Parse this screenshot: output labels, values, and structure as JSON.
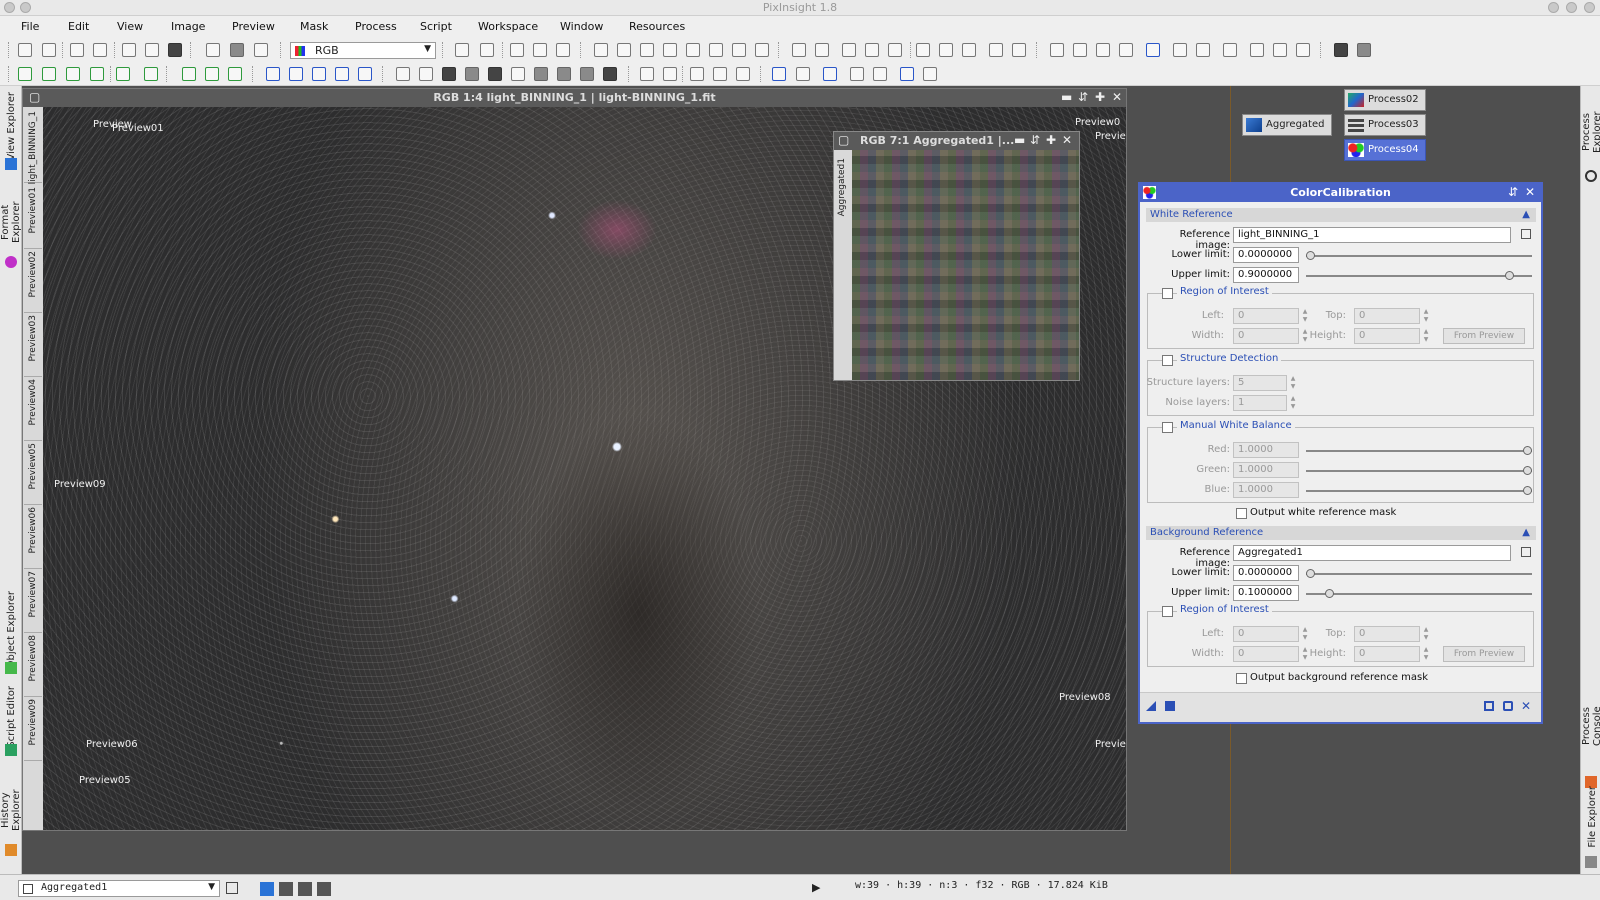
{
  "app": {
    "title": "PixInsight 1.8"
  },
  "menu": [
    "File",
    "Edit",
    "View",
    "Image",
    "Preview",
    "Mask",
    "Process",
    "Script",
    "Workspace",
    "Window",
    "Resources"
  ],
  "toolbar": {
    "channel_select": "RGB"
  },
  "left_dock": [
    "View Explorer",
    "Format Explorer",
    "Object Explorer",
    "Script Editor",
    "History Explorer"
  ],
  "right_dock": [
    "Process Explorer",
    "Process Console",
    "File Explorer"
  ],
  "main_window": {
    "title": "RGB 1:4 light_BINNING_1 | light-BINNING_1.fit",
    "tabs": [
      "light_BINNING_1",
      "Preview01",
      "Preview02",
      "Preview03",
      "Preview04",
      "Preview05",
      "Preview06",
      "Preview07",
      "Preview08",
      "Preview09"
    ],
    "labels": [
      "Preview01",
      "Preview09",
      "Preview06",
      "Preview05",
      "Preview0",
      "Preview08",
      "Previe",
      "Previe"
    ]
  },
  "agg_window": {
    "title": "RGB 7:1 Aggregated1 |...",
    "tab": "Aggregated1"
  },
  "process_icons": [
    {
      "label": "Aggregated"
    },
    {
      "label": "Process02"
    },
    {
      "label": "Process03"
    },
    {
      "label": "Process04"
    }
  ],
  "dialog": {
    "title": "ColorCalibration",
    "white_ref": {
      "header": "White Reference",
      "ref_image_label": "Reference image:",
      "ref_image": "light_BINNING_1",
      "lower_label": "Lower limit:",
      "lower": "0.0000000",
      "upper_label": "Upper limit:",
      "upper": "0.9000000",
      "lower_fraction": 0.0,
      "upper_fraction": 0.9
    },
    "roi1": {
      "label": "Region of Interest",
      "left_label": "Left:",
      "left": "0",
      "top_label": "Top:",
      "top": "0",
      "width_label": "Width:",
      "width": "0",
      "height_label": "Height:",
      "height": "0",
      "from_preview": "From Preview"
    },
    "structure": {
      "label": "Structure Detection",
      "layers_label": "Structure layers:",
      "layers": "5",
      "noise_label": "Noise layers:",
      "noise": "1"
    },
    "mwb": {
      "label": "Manual White Balance",
      "red_label": "Red:",
      "red": "1.0000",
      "green_label": "Green:",
      "green": "1.0000",
      "blue_label": "Blue:",
      "blue": "1.0000"
    },
    "output_white": "Output white reference mask",
    "bg_ref": {
      "header": "Background Reference",
      "ref_image_label": "Reference image:",
      "ref_image": "Aggregated1",
      "lower_label": "Lower limit:",
      "lower": "0.0000000",
      "upper_label": "Upper limit:",
      "upper": "0.1000000",
      "lower_fraction": 0.0,
      "upper_fraction": 0.1
    },
    "roi2": {
      "label": "Region of Interest",
      "left_label": "Left:",
      "left": "0",
      "top_label": "Top:",
      "top": "0",
      "width_label": "Width:",
      "width": "0",
      "height_label": "Height:",
      "height": "0",
      "from_preview": "From Preview"
    },
    "output_bg": "Output background reference mask"
  },
  "statusbar": {
    "view": "Aggregated1",
    "info": "w:39  ·  h:39  ·  n:3  ·  f32  ·  RGB  ·  17.824 KiB"
  }
}
